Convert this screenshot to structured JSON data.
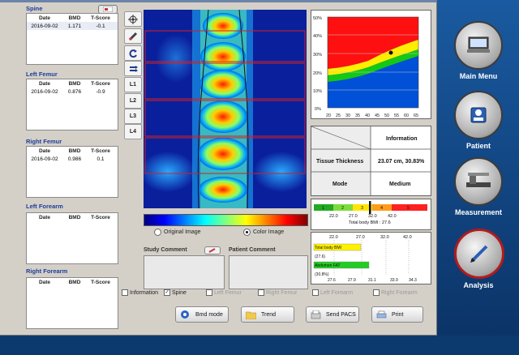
{
  "sections": [
    {
      "title": "Spine",
      "headers": [
        "Date",
        "BMD",
        "T-Score"
      ],
      "rows": [
        [
          "2016-09-02",
          "1.171",
          "-0.1"
        ]
      ]
    },
    {
      "title": "Left Femur",
      "headers": [
        "Date",
        "BMD",
        "T-Score"
      ],
      "rows": [
        [
          "2016-09-02",
          "0.876",
          "-0.9"
        ]
      ]
    },
    {
      "title": "Right Femur",
      "headers": [
        "Date",
        "BMD",
        "T-Score"
      ],
      "rows": [
        [
          "2016-09-02",
          "0.986",
          "0.1"
        ]
      ]
    },
    {
      "title": "Left Forearm",
      "headers": [
        "Date",
        "BMD",
        "T-Score"
      ],
      "rows": []
    },
    {
      "title": "Right Forearm",
      "headers": [
        "Date",
        "BMD",
        "T-Score"
      ],
      "rows": []
    }
  ],
  "tools": [
    "L1",
    "L2",
    "L3",
    "L4"
  ],
  "image_options": {
    "original": "Original Image",
    "color": "Color Image",
    "selected": "Color Image"
  },
  "comments": {
    "study": "Study Comment",
    "patient": "Patient Comment"
  },
  "percentile_chart": {
    "y_ticks": [
      "50%",
      "40%",
      "30%",
      "20%",
      "10%",
      "0%"
    ],
    "x_ticks": [
      "20",
      "25",
      "30",
      "35",
      "40",
      "45",
      "50",
      "55",
      "60",
      "65"
    ]
  },
  "info_table": {
    "header": "Information",
    "rows": [
      {
        "label": "Tissue Thickness",
        "value": "23.07 cm, 30.83%"
      },
      {
        "label": "Mode",
        "value": "Medium"
      }
    ]
  },
  "bmi_scale": {
    "segments": [
      "1",
      "2",
      "3",
      "4",
      "5"
    ],
    "ticks": [
      "22.0",
      "27.0",
      "32.0",
      "42.0"
    ],
    "caption": "Total body BMI : 27.6"
  },
  "fat_chart": {
    "ticks_top": [
      "22.0",
      "27.0",
      "32.0",
      "42.0"
    ],
    "bars": [
      {
        "label": "Total body BMI",
        "value": "(27.6)"
      },
      {
        "label": "Abdomen FAT",
        "value": "(30.8%)"
      }
    ],
    "ticks_bottom": [
      "27.6",
      "27.9",
      "31.1",
      "33.9",
      "34.3"
    ]
  },
  "checkboxes": [
    {
      "label": "Information",
      "checked": false,
      "enabled": true
    },
    {
      "label": "Spine",
      "checked": true,
      "enabled": true
    },
    {
      "label": "Left Femur",
      "checked": false,
      "enabled": false
    },
    {
      "label": "Right Femur",
      "checked": false,
      "enabled": false
    },
    {
      "label": "Left Forearm",
      "checked": false,
      "enabled": false
    },
    {
      "label": "Right Forearm",
      "checked": false,
      "enabled": false
    }
  ],
  "buttons": {
    "bmd_mode": "Bmd mode",
    "trend": "Trend",
    "send_pacs": "Send PACS",
    "print": "Print"
  },
  "nav": {
    "main_menu": "Main Menu",
    "patient": "Patient",
    "measurement": "Measurement",
    "analysis": "Analysis"
  }
}
